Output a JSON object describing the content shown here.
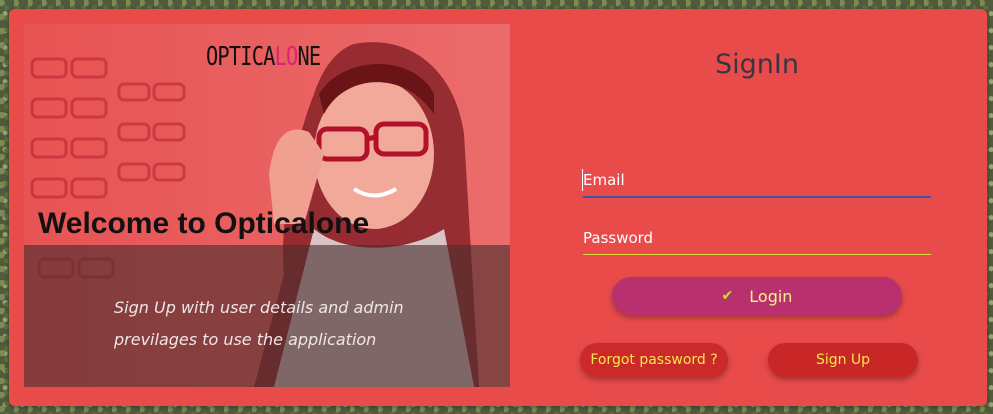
{
  "hero": {
    "brand_prefix": "OPTICA",
    "brand_accent": "L",
    "brand_o": "O",
    "brand_suffix": "NE",
    "welcome": "Welcome to Opticalone",
    "description": "Sign Up with user details and admin previlages to use the application"
  },
  "form": {
    "title": "SignIn",
    "email_placeholder": "Email",
    "password_placeholder": "Password",
    "login_label": "Login",
    "forgot_label": "Forgot  password ?",
    "signup_label": "Sign Up"
  },
  "colors": {
    "card": "#e94b4b",
    "login_button": "#b8316e",
    "secondary_buttons": "#c92727",
    "button_text": "#f3e64a",
    "email_underline": "#3f56a5",
    "password_underline": "#d7dd3c",
    "brand_accent": "#e0207a"
  },
  "icons": {
    "login": "check-icon"
  }
}
